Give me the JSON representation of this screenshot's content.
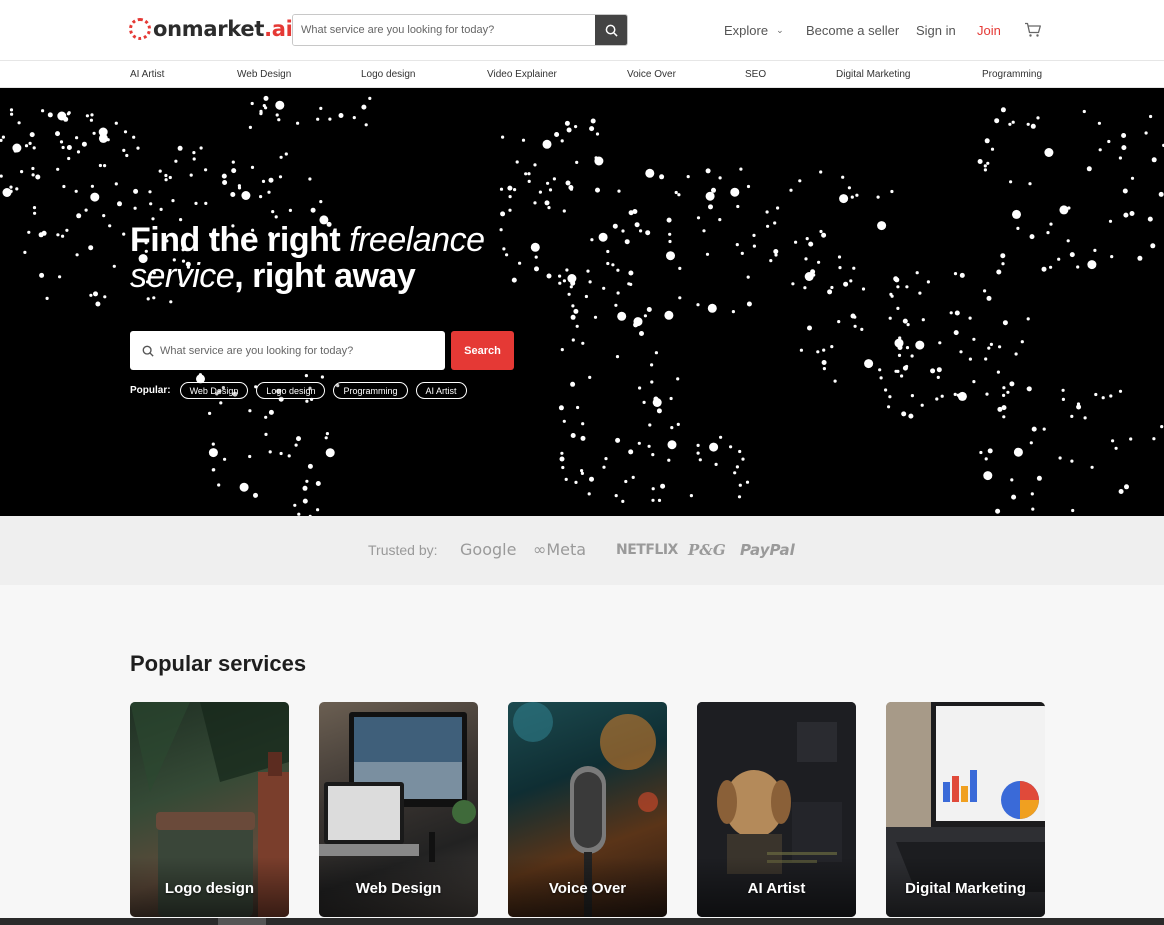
{
  "brand": {
    "name_main": "onmarket",
    "name_suffix": ".ai"
  },
  "header": {
    "search_placeholder": "What service are you looking for today?",
    "nav": {
      "explore": "Explore",
      "become_seller": "Become a seller",
      "sign_in": "Sign in",
      "join": "Join"
    }
  },
  "categories": [
    "AI Artist",
    "Web Design",
    "Logo design",
    "Video Explainer",
    "Voice Over",
    "SEO",
    "Digital Marketing",
    "Programming"
  ],
  "hero": {
    "title_part1": "Find the right ",
    "title_italic1": "freelance",
    "title_italic2": "service",
    "title_part2": ", right away",
    "search_placeholder": "What service are you looking for today?",
    "search_button": "Search",
    "popular_label": "Popular:",
    "popular_tags": [
      "Web Design",
      "Logo design",
      "Programming",
      "AI Artist"
    ]
  },
  "trusted": {
    "label": "Trusted by:",
    "brands": [
      "Google",
      "Meta",
      "NETFLIX",
      "P&G",
      "PayPal"
    ]
  },
  "popular_services": {
    "title": "Popular services",
    "cards": [
      "Logo design",
      "Web Design",
      "Voice Over",
      "AI Artist",
      "Digital Marketing"
    ]
  },
  "colors": {
    "accent": "#e53935",
    "hero_bg": "#000000",
    "text_dark": "#222222"
  }
}
